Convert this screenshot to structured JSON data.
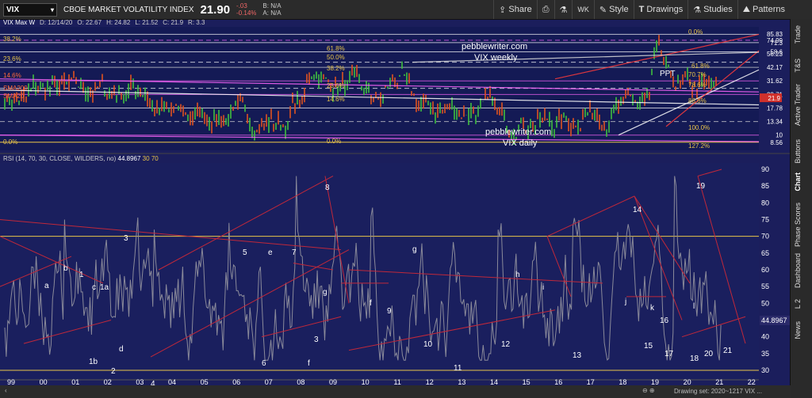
{
  "toolbar": {
    "symbol": "VIX",
    "title": "CBOE MARKET VOLATILITY INDEX",
    "price": "21.90",
    "change": "-.03",
    "change_pct": "-0.14%",
    "bid": "B: N/A",
    "ask": "A: N/A",
    "share_label": "Share",
    "period": "WK",
    "style_label": "Style",
    "drawings_label": "Drawings",
    "studies_label": "Studies",
    "patterns_label": "Patterns"
  },
  "info": {
    "title": "VIX Max W",
    "date": "D: 12/14/20",
    "open": "O: 22.67",
    "high": "H: 24.82",
    "low": "L: 21.52",
    "close": "C: 21.9",
    "range": "R: 3.3"
  },
  "rsi_label": "RSI (14, 70, 30, CLOSE, WILDERS, no)",
  "rsi_value": "44.8967",
  "rsi_levels": [
    "30",
    "70"
  ],
  "sidebar_tabs": [
    "Trade",
    "T&S",
    "Active Trader",
    "Buttons",
    "Chart",
    "Phase Scores",
    "Dashboard",
    "L 2",
    "News"
  ],
  "bottom_text": "Drawing set: 2020~1217 VIX ...",
  "chart_data": [
    {
      "type": "line",
      "title": "VIX Max W",
      "y_ticks": [
        "85.83",
        "74.99",
        "71.3",
        "58.6",
        "56.23",
        "42.17",
        "31.62",
        "23.71",
        "17.78",
        "13.34",
        "10",
        "8.56"
      ],
      "annotations": [
        "pebblewriter.com",
        "VIX weekly",
        "pebblewriter.com",
        "VIX daily",
        "PPT",
        "38.2%",
        "23.6%",
        "61.8%",
        "50.0%",
        "38.2%",
        "23.6%",
        "14.6%",
        "14.6%",
        "0.0%",
        "0.0%",
        "0.0%",
        "61.8%",
        "70.7%",
        "78.6%",
        "88.6%",
        "100.0%",
        "127.2%",
        "SMA200",
        "SMA20"
      ],
      "last_value": "21.9"
    },
    {
      "type": "line",
      "title": "RSI (14, 70, 30, CLOSE, WILDERS, no)",
      "x_tick_labels": [
        "99",
        "00",
        "01",
        "02",
        "03",
        "04",
        "05",
        "06",
        "07",
        "08",
        "09",
        "10",
        "11",
        "12",
        "13",
        "14",
        "15",
        "16",
        "17",
        "18",
        "19",
        "20",
        "21",
        "22"
      ],
      "y_tick_labels": [
        "90",
        "85",
        "80",
        "75",
        "70",
        "65",
        "60",
        "55",
        "50",
        "45",
        "40",
        "35",
        "30"
      ],
      "ylim": [
        30,
        90
      ],
      "overbought": 70,
      "oversold": 30,
      "last_value": 44.8967,
      "labels": [
        "a",
        "b",
        "1",
        "c",
        "1a",
        "1b",
        "2",
        "3",
        "4",
        "5",
        "6",
        "e",
        "7",
        "f",
        "3",
        "g",
        "8",
        "9",
        "f",
        "10",
        "11",
        "g",
        "12",
        "h",
        "13",
        "i",
        "14",
        "j",
        "15",
        "k",
        "16",
        "17",
        "18",
        "l",
        "19",
        "20",
        "21",
        "d"
      ]
    }
  ]
}
